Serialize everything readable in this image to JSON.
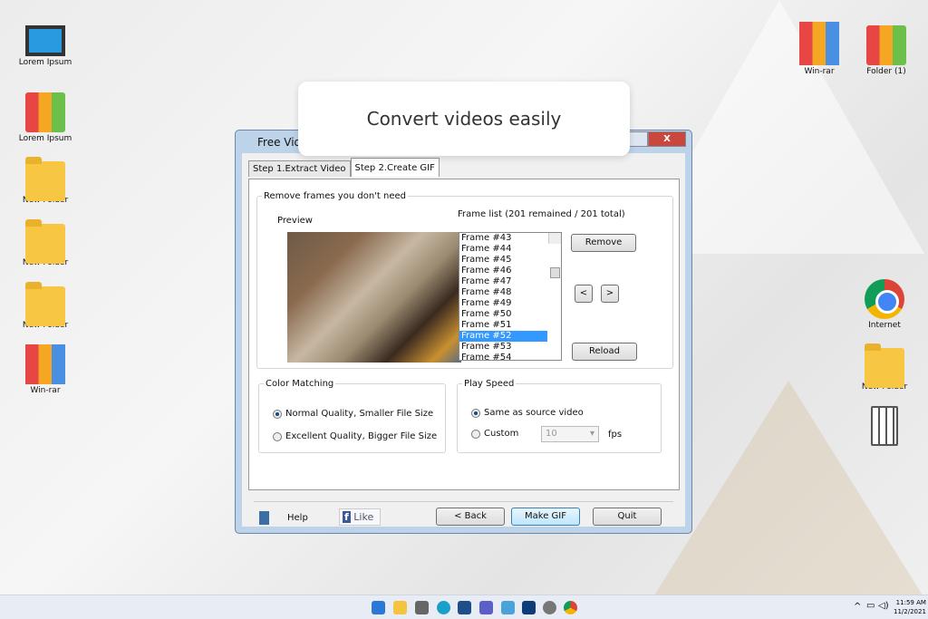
{
  "desktop": {
    "left": [
      "Lorem Ipsum",
      "Lorem Ipsum",
      "New Folder",
      "New Folder",
      "New Folder",
      "Win-rar"
    ],
    "right": [
      "Win-rar",
      "Folder (1)",
      "Internet",
      "New Folder"
    ]
  },
  "popup": "Convert videos easily",
  "window": {
    "title": "Free Vid",
    "close": "X",
    "tabs": [
      "Step 1.Extract Video",
      "Step 2.Create GIF"
    ],
    "remove_group": "Remove frames you don't need",
    "preview": "Preview",
    "frame_list_label": "Frame list (201 remained / 201 total)",
    "frames": [
      "Frame #43",
      "Frame #44",
      "Frame #45",
      "Frame #46",
      "Frame #47",
      "Frame #48",
      "Frame #49",
      "Frame #50",
      "Frame #51",
      "Frame #52",
      "Frame #53",
      "Frame #54"
    ],
    "selected_frame": "Frame #52",
    "remove": "Remove",
    "prev": "<",
    "next": ">",
    "reload": "Reload",
    "color_group": "Color Matching",
    "color_opts": [
      "Normal Quality, Smaller File Size",
      "Excellent Quality, Bigger File Size"
    ],
    "speed_group": "Play Speed",
    "speed_opts": [
      "Same as source video",
      "Custom"
    ],
    "fps_value": "10",
    "fps": "fps",
    "help": "Help",
    "like": "Like",
    "back": "< Back",
    "make": "Make GIF",
    "quit": "Quit"
  },
  "taskbar": {
    "time": "11:59 AM",
    "date": "11/2/2021"
  }
}
